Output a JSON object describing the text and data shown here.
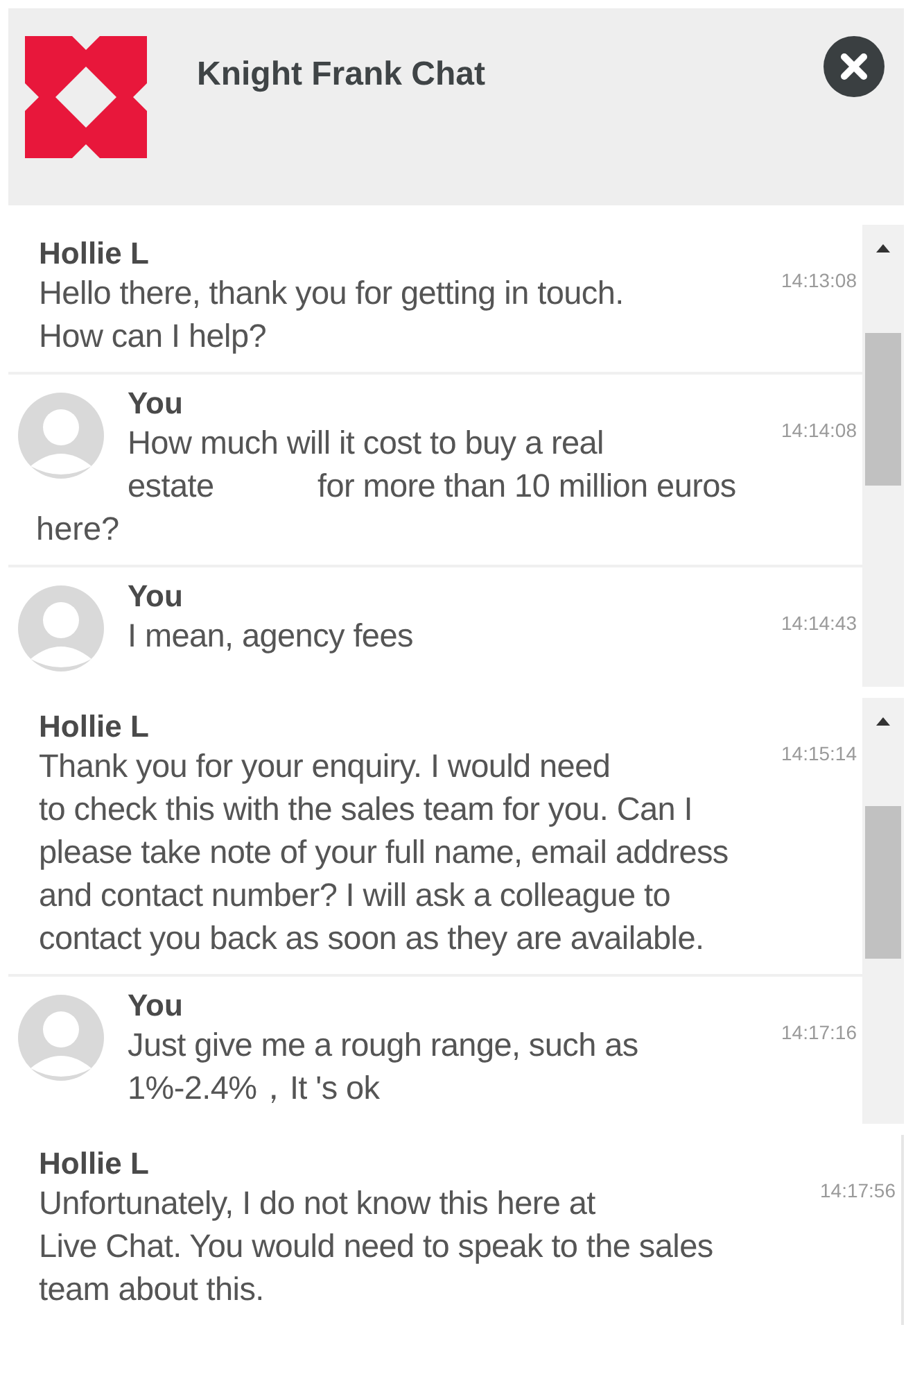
{
  "panels": [
    {
      "header": {
        "title": "Knight Frank Chat"
      },
      "scrollbar": true,
      "messages": [
        {
          "kind": "agent",
          "sender": "Hollie L",
          "time": "14:13:08",
          "lines": [
            "Hello there, thank you for getting in touch.",
            "How can I help?"
          ]
        },
        {
          "kind": "user",
          "sender": "You",
          "time": "14:14:08",
          "lines": [
            "How much will it cost to buy a real",
            "estate            for more than 10 million euros"
          ],
          "tail": "here?"
        },
        {
          "kind": "user",
          "sender": "You",
          "time": "14:14:43",
          "lines": [
            "I mean, agency fees"
          ]
        }
      ]
    },
    {
      "scrollbar": true,
      "messages": [
        {
          "kind": "agent",
          "sender": "Hollie L",
          "time": "14:15:14",
          "lines": [
            "Thank you for your enquiry. I would need",
            "to check this with the sales team for you. Can I",
            "please take note of your full name, email address",
            "and contact number? I will ask a colleague to",
            "contact you back as soon as they are available."
          ]
        },
        {
          "kind": "user",
          "sender": "You",
          "time": "14:17:16",
          "lines": [
            "Just give me a rough range, such as",
            "1%-2.4%，It 's ok"
          ]
        }
      ]
    },
    {
      "scrollbar": false,
      "messages": [
        {
          "kind": "agent",
          "sender": "Hollie L",
          "time": "14:17:56",
          "lines": [
            "Unfortunately, I do not know this here at",
            "Live Chat. You would need to speak to the sales",
            "team about this."
          ]
        }
      ]
    }
  ]
}
